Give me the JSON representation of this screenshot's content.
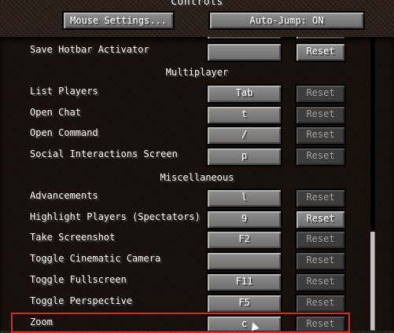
{
  "header": {
    "title": "Controls",
    "mouse_settings_label": "Mouse Settings...",
    "auto_jump_label": "Auto-Jump: ON"
  },
  "rows": {
    "save_hotbar": {
      "label": "Save Hotbar Activator",
      "key": "",
      "reset": "Reset"
    },
    "list_players": {
      "label": "List Players",
      "key": "Tab",
      "reset": "Reset"
    },
    "open_chat": {
      "label": "Open Chat",
      "key": "t",
      "reset": "Reset"
    },
    "open_command": {
      "label": "Open Command",
      "key": "/",
      "reset": "Reset"
    },
    "social": {
      "label": "Social Interactions Screen",
      "key": "p",
      "reset": "Reset"
    },
    "advancements": {
      "label": "Advancements",
      "key": "l",
      "reset": "Reset"
    },
    "highlight_players": {
      "label": "Highlight Players (Spectators)",
      "key": "9",
      "reset": "Reset"
    },
    "screenshot": {
      "label": "Take Screenshot",
      "key": "F2",
      "reset": "Reset"
    },
    "cinematic": {
      "label": "Toggle Cinematic Camera",
      "key": "",
      "reset": "Reset"
    },
    "fullscreen": {
      "label": "Toggle Fullscreen",
      "key": "F11",
      "reset": "Reset"
    },
    "perspective": {
      "label": "Toggle Perspective",
      "key": "F5",
      "reset": "Reset"
    },
    "zoom": {
      "label": "Zoom",
      "key": "c",
      "reset": "Reset"
    }
  },
  "sections": {
    "multiplayer": "Multiplayer",
    "miscellaneous": "Miscellaneous"
  },
  "colors": {
    "highlight": "#d62b2b",
    "button_active": "#7d7d7d",
    "button_disabled": "#3d3d3d"
  }
}
